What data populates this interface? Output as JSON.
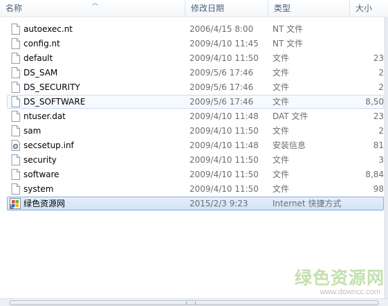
{
  "columns": {
    "name": "名称",
    "date": "修改日期",
    "type": "类型",
    "size": "大小"
  },
  "files": [
    {
      "name": "autoexec.nt",
      "date": "2006/4/15 8:00",
      "type": "NT 文件",
      "size": "",
      "icon": "file-icon"
    },
    {
      "name": "config.nt",
      "date": "2009/4/10 11:45",
      "type": "NT 文件",
      "size": "",
      "icon": "file-icon"
    },
    {
      "name": "default",
      "date": "2009/4/10 11:50",
      "type": "文件",
      "size": "23",
      "icon": "file-icon"
    },
    {
      "name": "DS_SAM",
      "date": "2009/5/6 17:46",
      "type": "文件",
      "size": "2",
      "icon": "file-icon"
    },
    {
      "name": "DS_SECURITY",
      "date": "2009/5/6 17:46",
      "type": "文件",
      "size": "2",
      "icon": "file-icon"
    },
    {
      "name": "DS_SOFTWARE",
      "date": "2009/5/6 17:46",
      "type": "文件",
      "size": "8,50",
      "icon": "file-icon"
    },
    {
      "name": "ntuser.dat",
      "date": "2009/4/10 11:48",
      "type": "DAT 文件",
      "size": "23",
      "icon": "file-icon"
    },
    {
      "name": "sam",
      "date": "2009/4/10 11:50",
      "type": "文件",
      "size": "2",
      "icon": "file-icon"
    },
    {
      "name": "secsetup.inf",
      "date": "2009/4/10 11:48",
      "type": "安装信息",
      "size": "81",
      "icon": "setup-info-icon"
    },
    {
      "name": "security",
      "date": "2009/4/10 11:50",
      "type": "文件",
      "size": "3",
      "icon": "file-icon"
    },
    {
      "name": "software",
      "date": "2009/4/10 11:50",
      "type": "文件",
      "size": "8,84",
      "icon": "file-icon"
    },
    {
      "name": "system",
      "date": "2009/4/10 11:50",
      "type": "文件",
      "size": "98",
      "icon": "file-icon"
    },
    {
      "name": "绿色资源网",
      "date": "2015/2/3 9:23",
      "type": "Internet 快捷方式",
      "size": "",
      "icon": "internet-shortcut-icon"
    }
  ],
  "hover_index": 5,
  "selected_index": 12,
  "watermark": {
    "text": "绿色资源网",
    "url": "www.downcc.com"
  },
  "colors": {
    "header_text": "#4c607a",
    "selection_border": "#84acdd",
    "hover_border": "#c6dcf5",
    "watermark_green": "#7aba48"
  }
}
